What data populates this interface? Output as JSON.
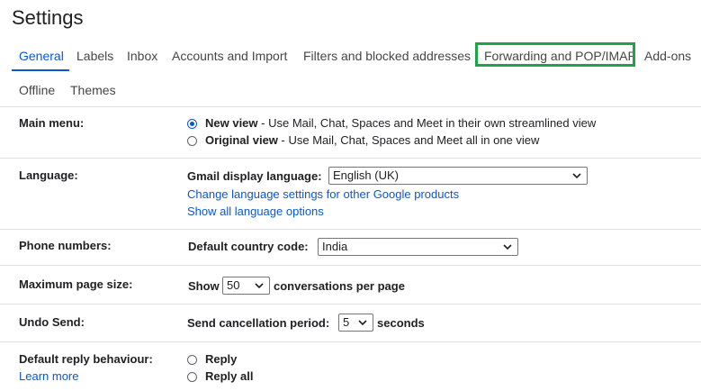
{
  "page": {
    "title": "Settings"
  },
  "tabs": [
    {
      "label": "General",
      "active": true
    },
    {
      "label": "Labels"
    },
    {
      "label": "Inbox"
    },
    {
      "label": "Accounts and Import"
    },
    {
      "label": "Filters and blocked addresses"
    },
    {
      "label": "Forwarding and POP/IMAP",
      "highlighted": true
    },
    {
      "label": "Add-ons"
    },
    {
      "label": "Offline"
    },
    {
      "label": "Themes"
    }
  ],
  "colors": {
    "accent": "#0b57d0",
    "highlight": "#1ea446",
    "divider": "#e0e0e0"
  },
  "main_menu": {
    "label": "Main menu:",
    "options": [
      {
        "title": "New view",
        "desc": " - Use Mail, Chat, Spaces and Meet in their own streamlined view",
        "selected": true
      },
      {
        "title": "Original view",
        "desc": " - Use Mail, Chat, Spaces and Meet all in one view",
        "selected": false
      }
    ]
  },
  "language": {
    "label": "Language:",
    "field_label": "Gmail display language:",
    "value": "English (UK)",
    "link1": "Change language settings for other Google products",
    "link2": "Show all language options"
  },
  "phone": {
    "label": "Phone numbers:",
    "field_label": "Default country code:",
    "value": "India"
  },
  "page_size": {
    "label": "Maximum page size:",
    "prefix": "Show",
    "value": "50",
    "suffix": "conversations per page"
  },
  "undo_send": {
    "label": "Undo Send:",
    "field_label": "Send cancellation period:",
    "value": "5",
    "suffix": "seconds"
  },
  "reply": {
    "label": "Default reply behaviour:",
    "learn_more": "Learn more",
    "options": [
      {
        "label": "Reply",
        "selected": false
      },
      {
        "label": "Reply all",
        "selected": false
      }
    ]
  }
}
